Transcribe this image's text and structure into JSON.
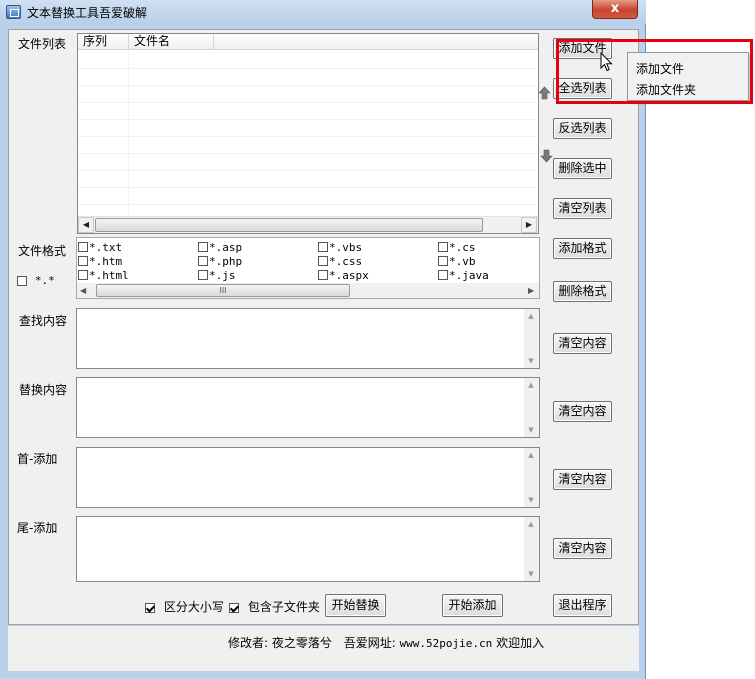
{
  "window": {
    "title": "文本替换工具吾爱破解",
    "close_glyph": "x"
  },
  "file_list": {
    "label": "文件列表",
    "columns": [
      "序列",
      "文件名"
    ]
  },
  "buttons": {
    "add_file": "添加文件",
    "select_all": "全选列表",
    "invert_select": "反选列表",
    "delete_selected": "删除选中",
    "clear_list": "清空列表",
    "add_format": "添加格式",
    "delete_format": "删除格式",
    "clear_find": "清空内容",
    "clear_replace": "清空内容",
    "clear_prefix": "清空内容",
    "clear_suffix": "清空内容",
    "start_replace": "开始替换",
    "start_add": "开始添加",
    "exit": "退出程序"
  },
  "formats": {
    "label": "文件格式",
    "all_option": "*.*",
    "all_checked": false,
    "items": [
      [
        "*.txt",
        "*.asp",
        "*.vbs",
        "*.cs"
      ],
      [
        "*.htm",
        "*.php",
        "*.css",
        "*.vb"
      ],
      [
        "*.html",
        "*.js",
        "*.aspx",
        "*.java"
      ]
    ],
    "scroll_thumb_glyph": "III"
  },
  "fields": {
    "find_label": "查找内容",
    "replace_label": "替换内容",
    "prefix_label": "首-添加",
    "suffix_label": "尾-添加"
  },
  "options": {
    "case_sensitive_label": "区分大小写",
    "case_sensitive": true,
    "include_subfolders_label": "包含子文件夹",
    "include_subfolders": true
  },
  "footer": {
    "modifier": "修改者: 夜之零落兮",
    "site_label": "吾爱网址:",
    "site_url": "www.52pojie.cn",
    "welcome": "欢迎加入"
  },
  "context_menu": {
    "items": [
      "添加文件",
      "添加文件夹"
    ]
  },
  "icons": {
    "move_up": "up-arrow-icon",
    "move_down": "down-arrow-icon"
  },
  "colors": {
    "highlight": "#e4000e",
    "close_button": "#c7452b"
  }
}
